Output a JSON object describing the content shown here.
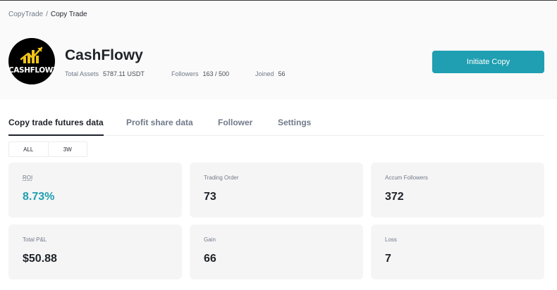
{
  "breadcrumb": {
    "parent": "CopyTrade",
    "separator": "/",
    "current": "Copy Trade"
  },
  "trader": {
    "avatar_text": "CASHFLOWY",
    "name": "CashFlowy",
    "total_assets_label": "Total Assets",
    "total_assets_value": "5787.11 USDT",
    "followers_label": "Followers",
    "followers_value": "163 / 500",
    "joined_label": "Joined",
    "joined_value": "56"
  },
  "initiate_copy_label": "Initiate Copy",
  "tabs": [
    {
      "label": "Copy trade futures data",
      "active": true
    },
    {
      "label": "Profit share data",
      "active": false
    },
    {
      "label": "Follower",
      "active": false
    },
    {
      "label": "Settings",
      "active": false
    }
  ],
  "range_options": [
    "ALL",
    "3W"
  ],
  "stats": [
    {
      "label": "ROI",
      "value": "8.73%"
    },
    {
      "label": "Trading Order",
      "value": "73"
    },
    {
      "label": "Accum Followers",
      "value": "372"
    },
    {
      "label": "Total P&L",
      "value": "$50.88"
    },
    {
      "label": "Gain",
      "value": "66"
    },
    {
      "label": "Loss",
      "value": "7"
    }
  ],
  "colors": {
    "accent": "#1f9fb1",
    "logo_yellow": "#f0c419",
    "text_primary": "#1e2329",
    "text_secondary": "#707a8a"
  },
  "icons": {
    "avatar_logo": "rising-chart-bars-icon"
  }
}
